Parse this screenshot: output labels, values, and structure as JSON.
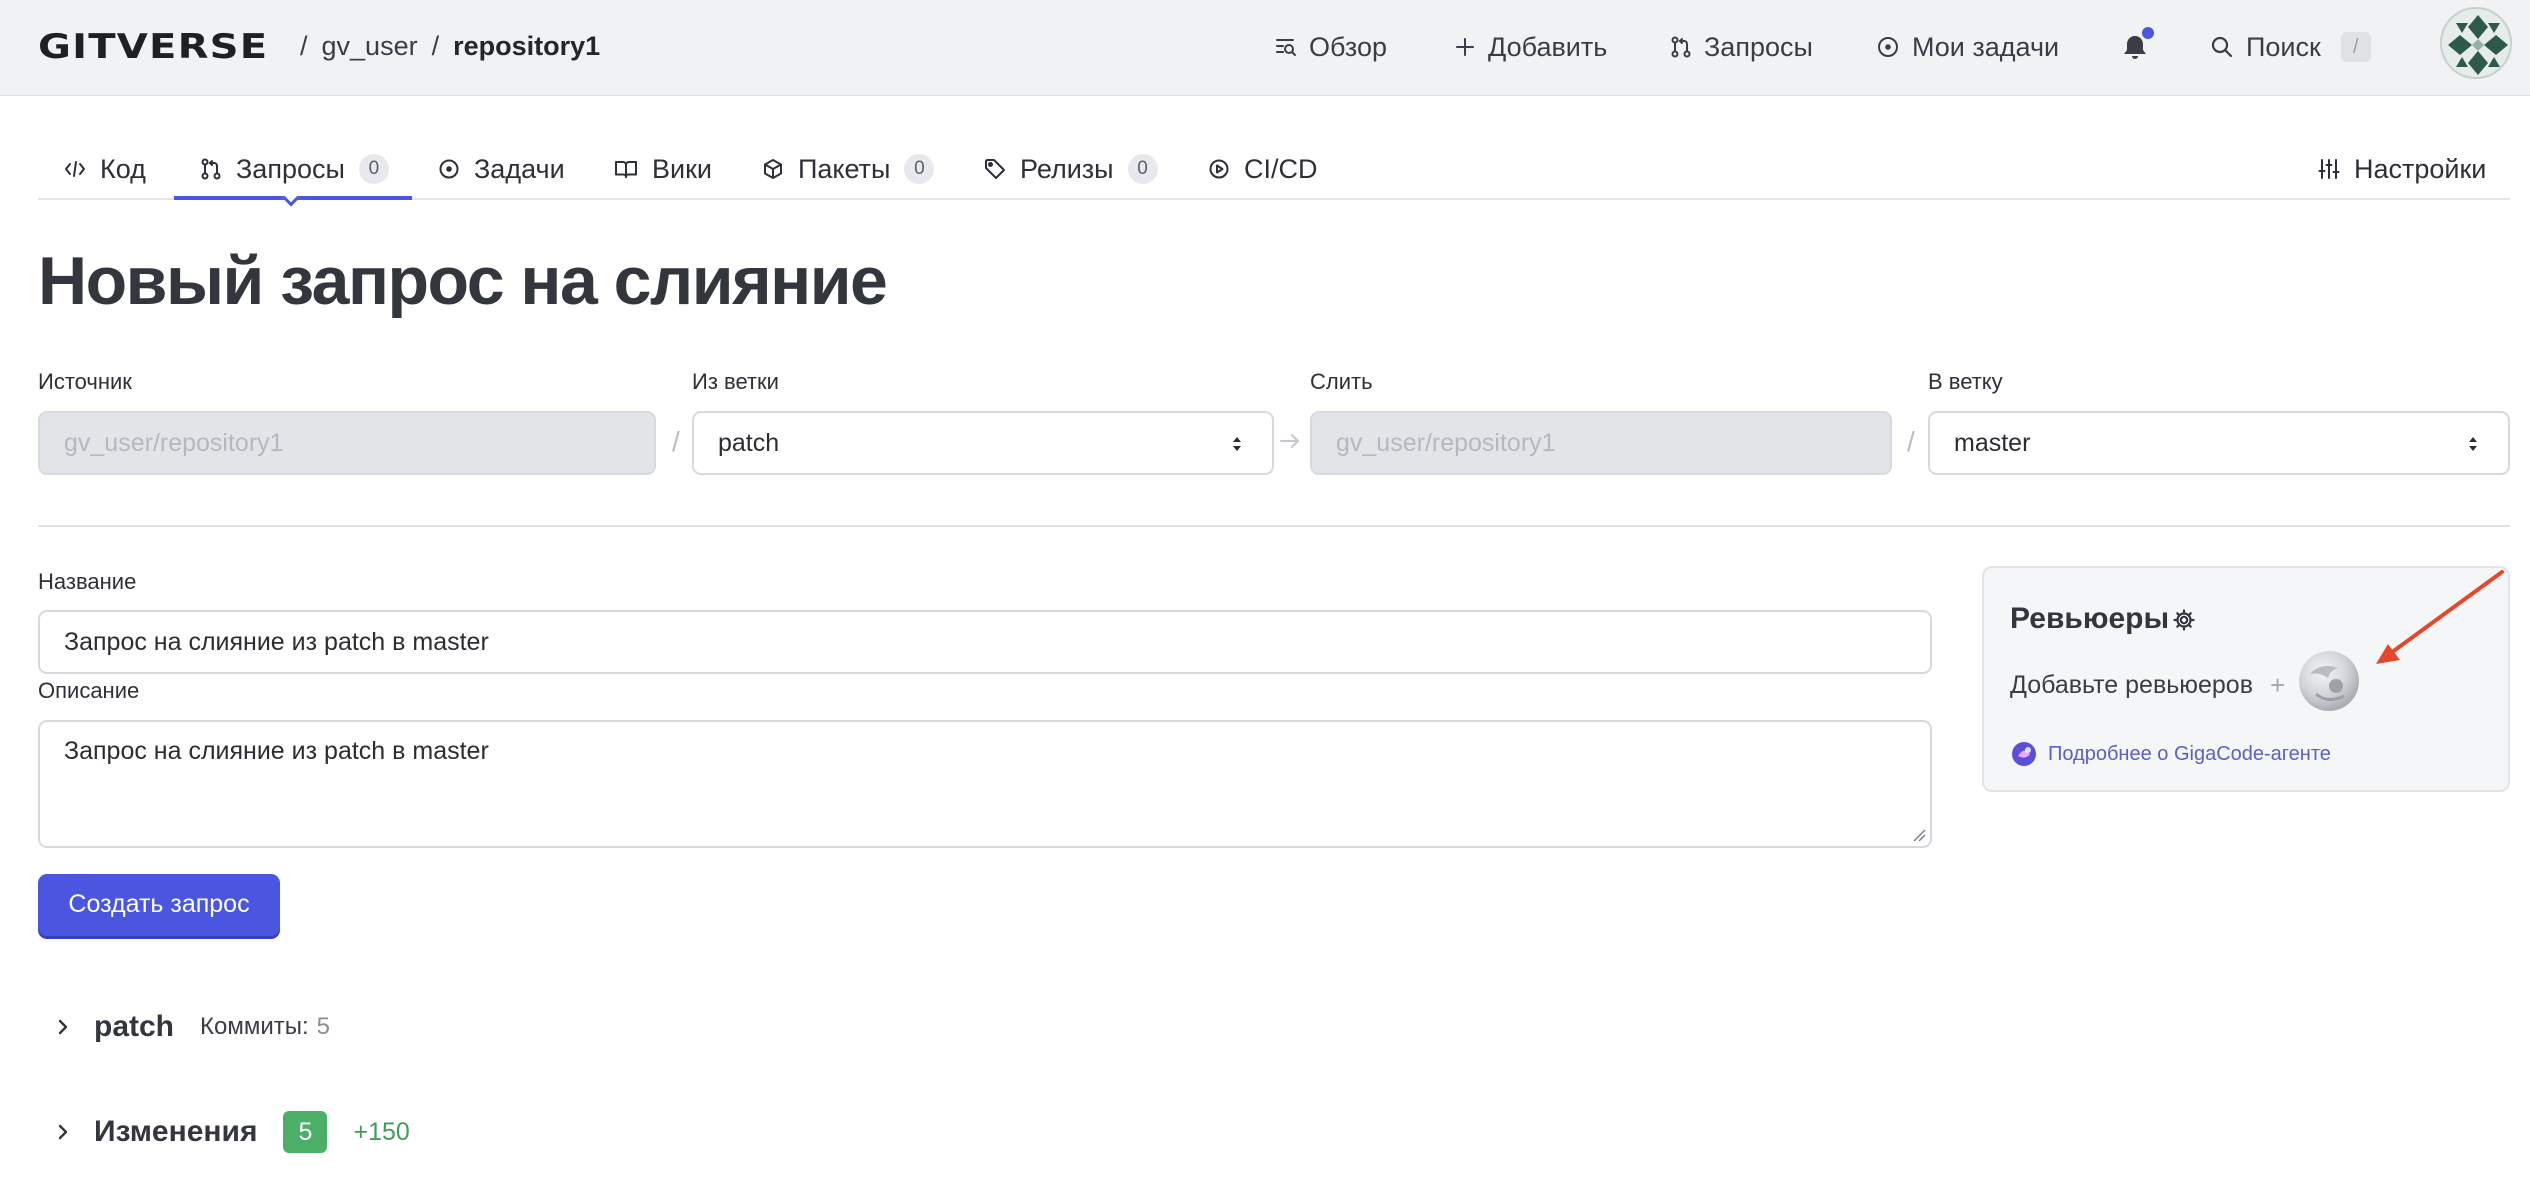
{
  "header": {
    "logo": "GITVERSE",
    "breadcrumb": {
      "separator": "/",
      "user": "gv_user",
      "repo": "repository1"
    },
    "nav": {
      "overview": "Обзор",
      "add": "Добавить",
      "requests": "Запросы",
      "my_tasks": "Мои задачи",
      "search": "Поиск",
      "search_shortcut": "/"
    },
    "notification_dot_color": "#4a56e0"
  },
  "repo_tabs": {
    "code": {
      "label": "Код"
    },
    "requests": {
      "label": "Запросы",
      "count": "0"
    },
    "tasks": {
      "label": "Задачи"
    },
    "wiki": {
      "label": "Вики"
    },
    "packages": {
      "label": "Пакеты",
      "count": "0"
    },
    "releases": {
      "label": "Релизы",
      "count": "0"
    },
    "cicd": {
      "label": "CI/CD"
    },
    "settings": {
      "label": "Настройки"
    },
    "active": "requests"
  },
  "page": {
    "title": "Новый запрос на слияние"
  },
  "branches": {
    "source_label": "Источник",
    "source_value": "gv_user/repository1",
    "from_branch_label": "Из ветки",
    "from_branch_value": "patch",
    "merge_label": "Слить",
    "merge_value": "gv_user/repository1",
    "to_branch_label": "В ветку",
    "to_branch_value": "master",
    "separator": "/"
  },
  "form": {
    "title_label": "Название",
    "title_value": "Запрос на слияние из patch в master",
    "description_label": "Описание",
    "description_value": "Запрос на слияние из patch в master",
    "submit_label": "Создать запрос"
  },
  "reviewers": {
    "title": "Ревьюеры",
    "add_text": "Добавьте ревьюеров",
    "add_symbol": "+",
    "link_text": "Подробнее о GigaCode-агенте"
  },
  "sections": {
    "branch": {
      "name": "patch",
      "commits_label": "Коммиты:",
      "commits_count": "5"
    },
    "changes": {
      "name": "Изменения",
      "files_count": "5",
      "additions": "+150"
    }
  },
  "colors": {
    "accent": "#4a56e0",
    "success": "#4caf68",
    "annotation_arrow": "#e5472c"
  }
}
